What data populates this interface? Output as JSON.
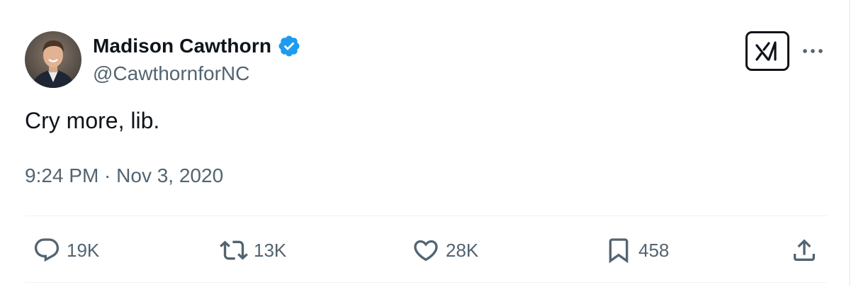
{
  "tweet": {
    "author": {
      "display_name": "Madison Cawthorn",
      "handle": "@CawthornforNC",
      "verified": true
    },
    "text": "Cry more, lib.",
    "timestamp": "9:24 PM · Nov 3, 2020"
  },
  "actions": {
    "replies": "19K",
    "retweets": "13K",
    "likes": "28K",
    "bookmarks": "458"
  },
  "icons": {
    "verified": "verified-badge-icon",
    "logo": "grok-logo-icon",
    "more": "more-dots-icon",
    "reply": "reply-icon",
    "retweet": "retweet-icon",
    "like": "heart-icon",
    "bookmark": "bookmark-icon",
    "share": "share-icon"
  },
  "colors": {
    "text_primary": "#0f1419",
    "text_secondary": "#536471",
    "verified_blue": "#1d9bf0",
    "divider": "#eff3f4"
  }
}
